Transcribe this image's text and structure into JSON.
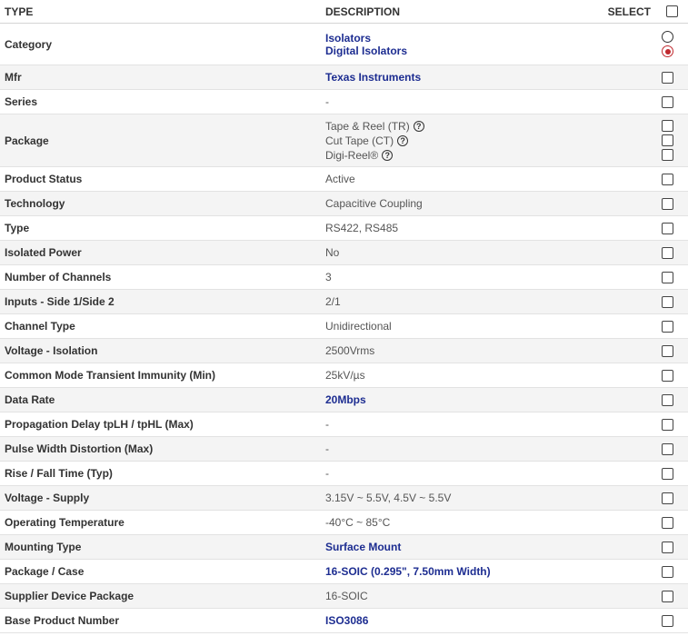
{
  "header": {
    "type": "TYPE",
    "description": "DESCRIPTION",
    "select": "SELECT"
  },
  "rows": [
    {
      "label": "Category",
      "links": [
        "Isolators",
        "Digital Isolators"
      ],
      "select": "radio",
      "radio_checked": 1
    },
    {
      "label": "Mfr",
      "value": "Texas Instruments",
      "link": true
    },
    {
      "label": "Series",
      "value": "-"
    },
    {
      "label": "Package",
      "package_options": [
        "Tape & Reel (TR)",
        "Cut Tape (CT)",
        "Digi-Reel®"
      ]
    },
    {
      "label": "Product Status",
      "value": "Active"
    },
    {
      "label": "Technology",
      "value": "Capacitive Coupling"
    },
    {
      "label": "Type",
      "value": "RS422, RS485"
    },
    {
      "label": "Isolated Power",
      "value": "No"
    },
    {
      "label": "Number of Channels",
      "value": "3"
    },
    {
      "label": "Inputs - Side 1/Side 2",
      "value": "2/1"
    },
    {
      "label": "Channel Type",
      "value": "Unidirectional"
    },
    {
      "label": "Voltage - Isolation",
      "value": "2500Vrms"
    },
    {
      "label": "Common Mode Transient Immunity (Min)",
      "value": "25kV/µs"
    },
    {
      "label": "Data Rate",
      "value": "20Mbps",
      "link": true
    },
    {
      "label": "Propagation Delay tpLH / tpHL (Max)",
      "value": "-"
    },
    {
      "label": "Pulse Width Distortion (Max)",
      "value": "-"
    },
    {
      "label": "Rise / Fall Time (Typ)",
      "value": "-"
    },
    {
      "label": "Voltage - Supply",
      "value": "3.15V ~ 5.5V, 4.5V ~ 5.5V"
    },
    {
      "label": "Operating Temperature",
      "value": "-40°C ~ 85°C"
    },
    {
      "label": "Mounting Type",
      "value": "Surface Mount",
      "link": true
    },
    {
      "label": "Package / Case",
      "value": "16-SOIC (0.295\", 7.50mm Width)",
      "link": true
    },
    {
      "label": "Supplier Device Package",
      "value": "16-SOIC"
    },
    {
      "label": "Base Product Number",
      "value": "ISO3086",
      "link": true
    }
  ],
  "icons": {
    "help": "question-circle-icon"
  },
  "colors": {
    "link": "#1d2d91",
    "radio_selected": "#c0282d",
    "alt_row": "#f4f4f4"
  }
}
